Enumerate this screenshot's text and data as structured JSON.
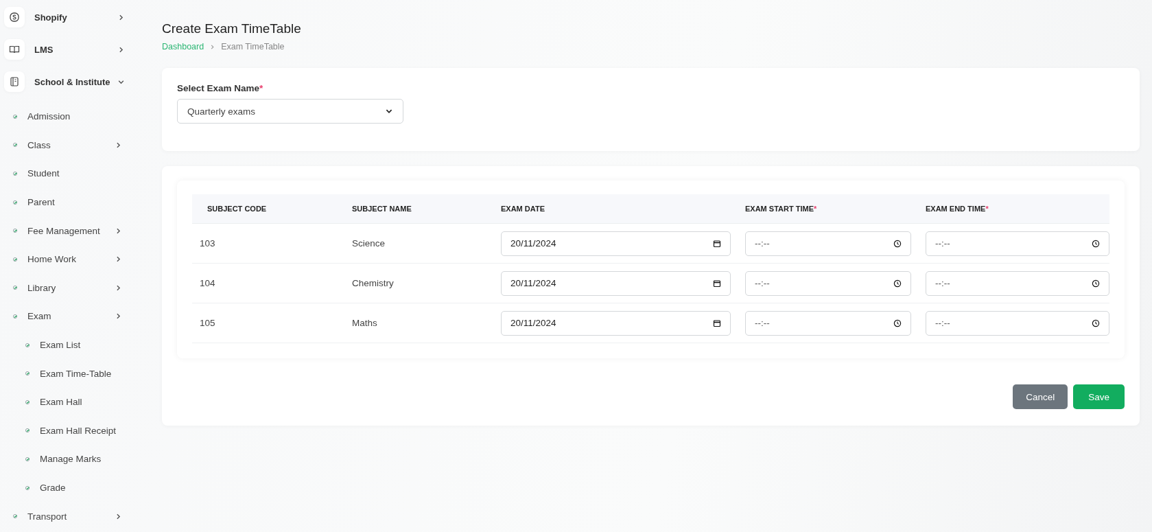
{
  "sidebar": {
    "items": [
      {
        "kind": "module",
        "label": "Shopify",
        "expanded": false
      },
      {
        "kind": "module",
        "label": "LMS",
        "expanded": false
      },
      {
        "kind": "module",
        "label": "School & Institute",
        "expanded": true,
        "children": [
          {
            "label": "Admission"
          },
          {
            "label": "Class",
            "expanded": false
          },
          {
            "label": "Student"
          },
          {
            "label": "Parent"
          },
          {
            "label": "Fee Management",
            "expanded": false
          },
          {
            "label": "Home Work",
            "expanded": false
          },
          {
            "label": "Library",
            "expanded": false
          },
          {
            "label": "Exam",
            "expanded": false,
            "children": [
              {
                "label": "Exam List"
              },
              {
                "label": "Exam Time-Table"
              },
              {
                "label": "Exam Hall"
              },
              {
                "label": "Exam Hall Receipt"
              },
              {
                "label": "Manage Marks"
              },
              {
                "label": "Grade"
              }
            ]
          },
          {
            "label": "Transport",
            "expanded": false
          }
        ]
      }
    ]
  },
  "page": {
    "title": "Create Exam TimeTable",
    "breadcrumb": [
      {
        "label": "Dashboard",
        "kind": "link"
      },
      {
        "label": "Exam TimeTable",
        "kind": "current"
      }
    ]
  },
  "exam_select": {
    "label": "Select Exam Name",
    "required_mark": "*",
    "value": "Quarterly exams"
  },
  "table": {
    "columns": [
      {
        "label": "SUBJECT CODE"
      },
      {
        "label": "SUBJECT NAME"
      },
      {
        "label": "EXAM DATE"
      },
      {
        "label": "EXAM START TIME",
        "required_mark": "*"
      },
      {
        "label": "EXAM END TIME",
        "required_mark": "*"
      }
    ],
    "rows": [
      {
        "code": "103",
        "name": "Science",
        "date": "20/11/2024",
        "start_placeholder": "--:--",
        "end_placeholder": "--:--"
      },
      {
        "code": "104",
        "name": "Chemistry",
        "date": "20/11/2024",
        "start_placeholder": "--:--",
        "end_placeholder": "--:--"
      },
      {
        "code": "105",
        "name": "Maths",
        "date": "20/11/2024",
        "start_placeholder": "--:--",
        "end_placeholder": "--:--"
      }
    ]
  },
  "buttons": [
    {
      "label": "Cancel",
      "kind": "secondary"
    },
    {
      "label": "Save",
      "kind": "primary"
    }
  ]
}
